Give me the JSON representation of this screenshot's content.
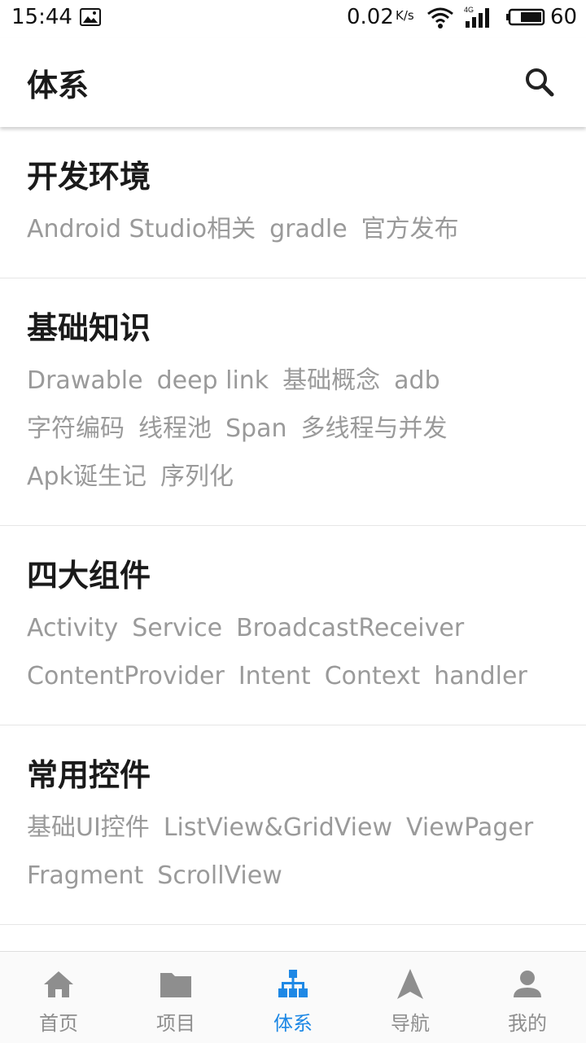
{
  "status_bar": {
    "time": "15:44",
    "speed": "0.02",
    "speed_unit": "K/s",
    "network": "4G",
    "battery": "60"
  },
  "app_bar": {
    "title": "体系",
    "search_icon": "search-icon"
  },
  "categories": [
    {
      "title": "开发环境",
      "tags": [
        "Android Studio相关",
        "gradle",
        "官方发布"
      ]
    },
    {
      "title": "基础知识",
      "tags": [
        "Drawable",
        "deep link",
        "基础概念",
        "adb",
        "字符编码",
        "线程池",
        "Span",
        "多线程与并发",
        "Apk诞生记",
        "序列化"
      ]
    },
    {
      "title": "四大组件",
      "tags": [
        "Activity",
        "Service",
        "BroadcastReceiver",
        "ContentProvider",
        "Intent",
        "Context",
        "handler"
      ]
    },
    {
      "title": "常用控件",
      "tags": [
        "基础UI控件",
        "ListView&GridView",
        "ViewPager",
        "Fragment",
        "ScrollView"
      ]
    }
  ],
  "bottom_nav": {
    "items": [
      {
        "label": "首页",
        "icon": "home-icon"
      },
      {
        "label": "项目",
        "icon": "folder-icon"
      },
      {
        "label": "体系",
        "icon": "hierarchy-icon"
      },
      {
        "label": "导航",
        "icon": "navigation-icon"
      },
      {
        "label": "我的",
        "icon": "person-icon"
      }
    ],
    "active_index": 2
  },
  "colors": {
    "accent": "#1e88e5",
    "inactive": "#8e8e8e",
    "tag_text": "#9a9a9a",
    "title_text": "#1a1a1a"
  }
}
